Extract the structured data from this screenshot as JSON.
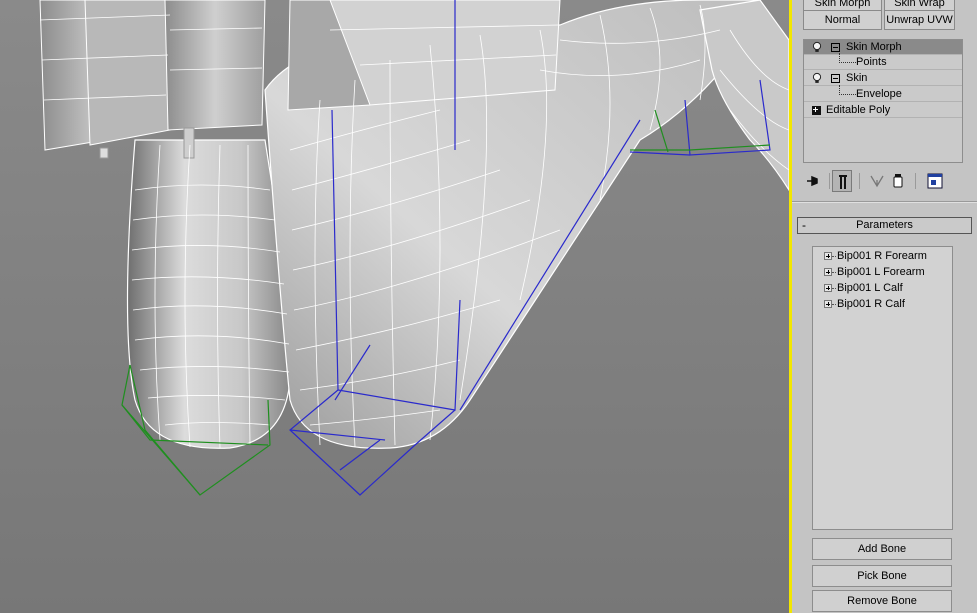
{
  "modifier_buttons": {
    "skin_morph": "Skin Morph",
    "skin_wrap": "Skin Wrap",
    "normal": "Normal",
    "unwrap_uvw": "Unwrap UVW"
  },
  "modifier_stack": {
    "items": [
      {
        "label": "Skin Morph",
        "selected": true,
        "type": "modifier"
      },
      {
        "label": "Points",
        "type": "sub-object"
      },
      {
        "label": "Skin",
        "type": "modifier"
      },
      {
        "label": "Envelope",
        "type": "sub-object"
      },
      {
        "label": "Editable Poly",
        "type": "base-object"
      }
    ]
  },
  "stack_toolbar": {
    "icons": [
      "pin-stack-icon",
      "show-end-result-icon",
      "make-unique-icon",
      "remove-modifier-icon",
      "configure-modifier-sets-icon"
    ]
  },
  "rollout": {
    "collapse_symbol": "-",
    "title": "Parameters"
  },
  "bones": [
    {
      "label": "Bip001 R Forearm"
    },
    {
      "label": "Bip001 L Forearm"
    },
    {
      "label": "Bip001 L Calf"
    },
    {
      "label": "Bip001 R Calf"
    }
  ],
  "actions": {
    "add_bone": "Add Bone",
    "pick_bone": "Pick Bone",
    "remove_bone": "Remove Bone"
  },
  "colors": {
    "viewport_bg": "#7d7d7d",
    "active_viewport_border": "#f2e600",
    "wire": "#ffffff",
    "bone_blue": "#2a2acc",
    "bone_green": "#1f8f1f",
    "panel_bg": "#c4c4c4"
  }
}
